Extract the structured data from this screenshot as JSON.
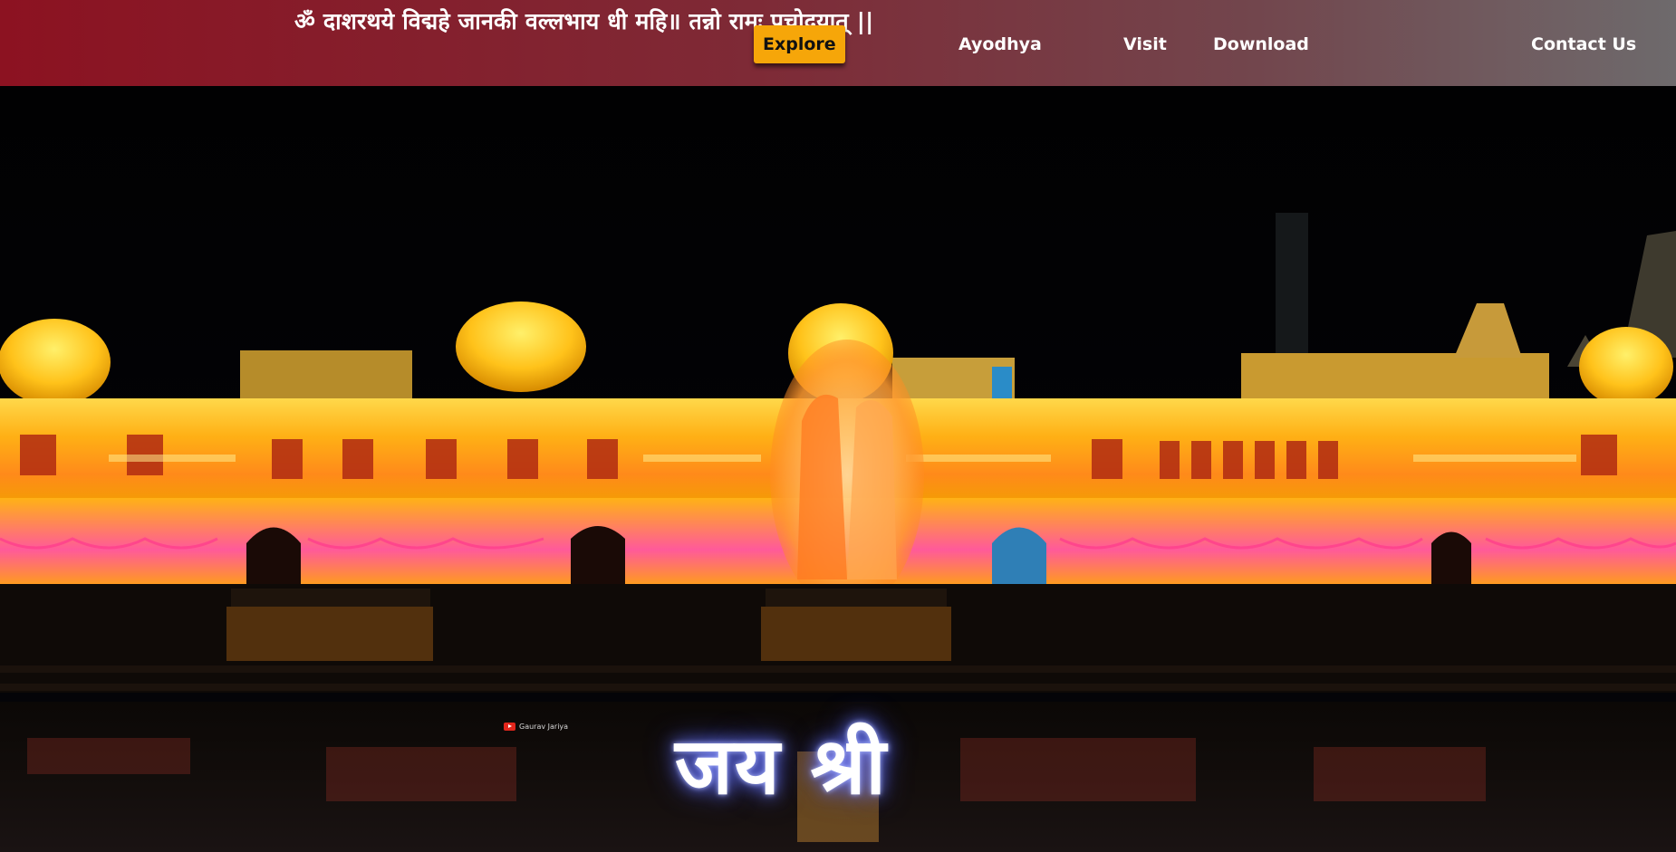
{
  "header": {
    "mantra": "ॐ दाशरथये विद्महे जानकी वल्लभाय धी महि॥ तन्नो रामः प्रचोदयात् ||",
    "nav": [
      {
        "label": "Explore",
        "active": true
      },
      {
        "label": "Ayodhya",
        "active": false
      },
      {
        "label": "Visit",
        "active": false
      },
      {
        "label": "Download",
        "active": false
      },
      {
        "label": "Contact Us",
        "active": false
      }
    ]
  },
  "hero": {
    "title": "जय श्री",
    "watermark": "Gaurav Jariya"
  },
  "colors": {
    "header_start": "#8c1221",
    "header_end": "#6e6a6c",
    "accent": "#f6a609",
    "nav_text": "#ffffff"
  },
  "icons": {
    "watermark_icon": "youtube-icon"
  }
}
